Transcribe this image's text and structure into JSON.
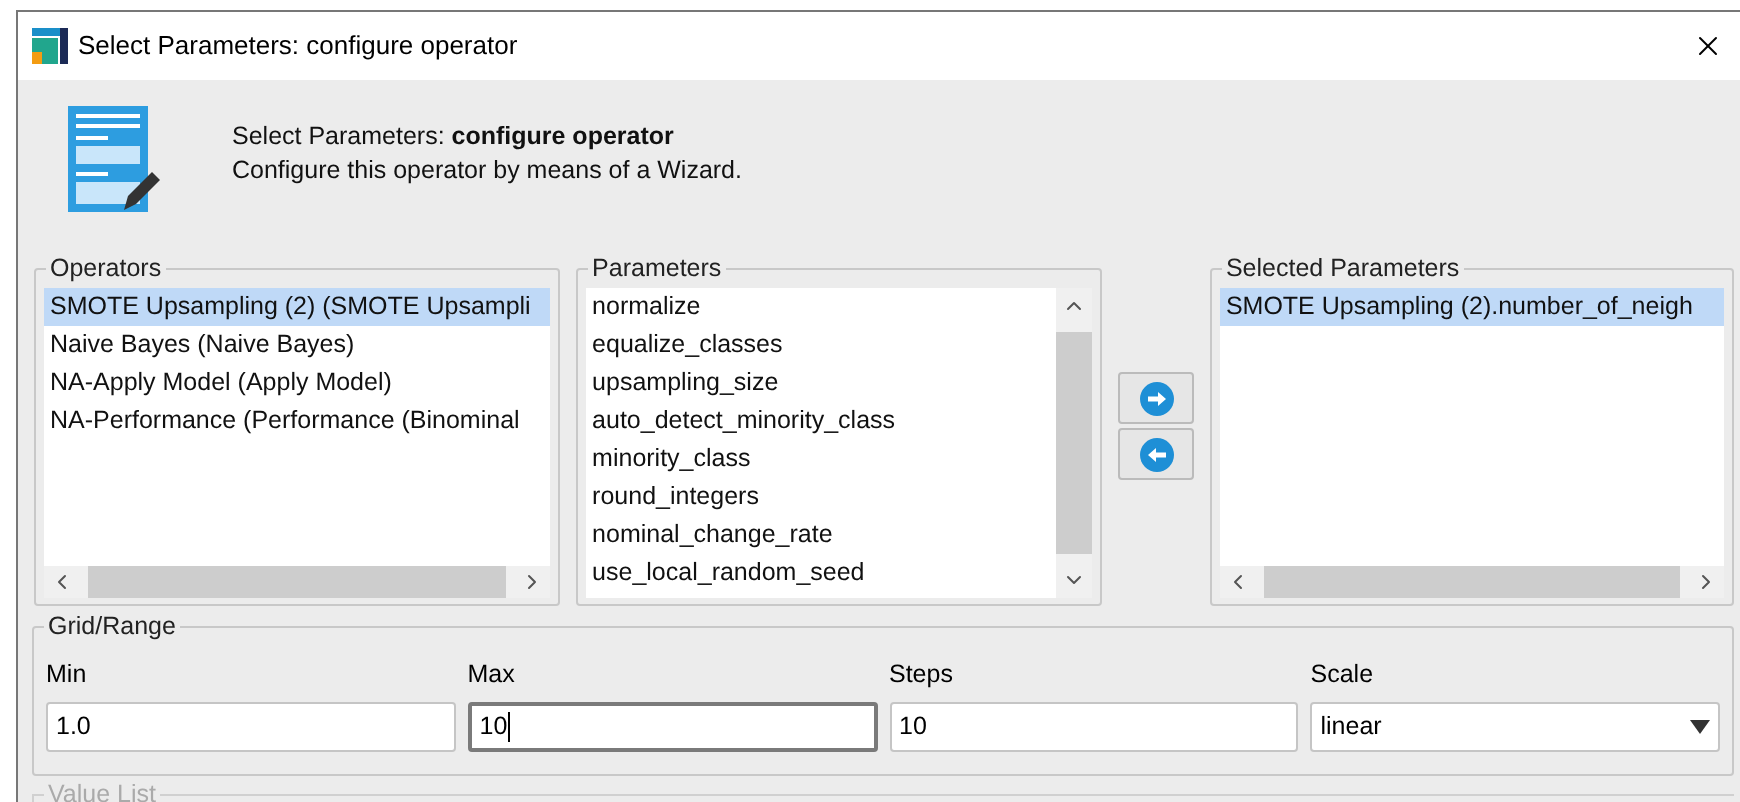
{
  "window": {
    "title": "Select Parameters: configure operator"
  },
  "header": {
    "title": "Select Parameters: **configure operator**",
    "subtitle": "Configure this operator by means of a Wizard."
  },
  "operators": {
    "label": "Operators",
    "items": [
      {
        "text": "SMOTE Upsampling (2) (SMOTE Upsampli",
        "selected": true
      },
      {
        "text": "Naive Bayes (Naive Bayes)",
        "selected": false
      },
      {
        "text": "NA-Apply Model (Apply Model)",
        "selected": false
      },
      {
        "text": "NA-Performance (Performance (Binominal",
        "selected": false
      }
    ]
  },
  "parameters": {
    "label": "Parameters",
    "items": [
      {
        "text": "normalize",
        "selected": false
      },
      {
        "text": "equalize_classes",
        "selected": false
      },
      {
        "text": "upsampling_size",
        "selected": false
      },
      {
        "text": "auto_detect_minority_class",
        "selected": false
      },
      {
        "text": "minority_class",
        "selected": false
      },
      {
        "text": "round_integers",
        "selected": false
      },
      {
        "text": "nominal_change_rate",
        "selected": false
      },
      {
        "text": "use_local_random_seed",
        "selected": false
      }
    ]
  },
  "selected_parameters": {
    "label": "Selected Parameters",
    "items": [
      {
        "text": "SMOTE Upsampling (2).number_of_neigh",
        "selected": true
      }
    ]
  },
  "grid_range": {
    "label": "Grid/Range",
    "fields": [
      {
        "kind": "text",
        "label": "Min",
        "value": "1.0",
        "focused": false
      },
      {
        "kind": "text",
        "label": "Max",
        "value": "10",
        "focused": true
      },
      {
        "kind": "text",
        "label": "Steps",
        "value": "10",
        "focused": false
      },
      {
        "kind": "select",
        "label": "Scale",
        "value": "linear",
        "focused": false
      }
    ]
  },
  "value_list": {
    "label": "Value List",
    "disabled": true
  }
}
